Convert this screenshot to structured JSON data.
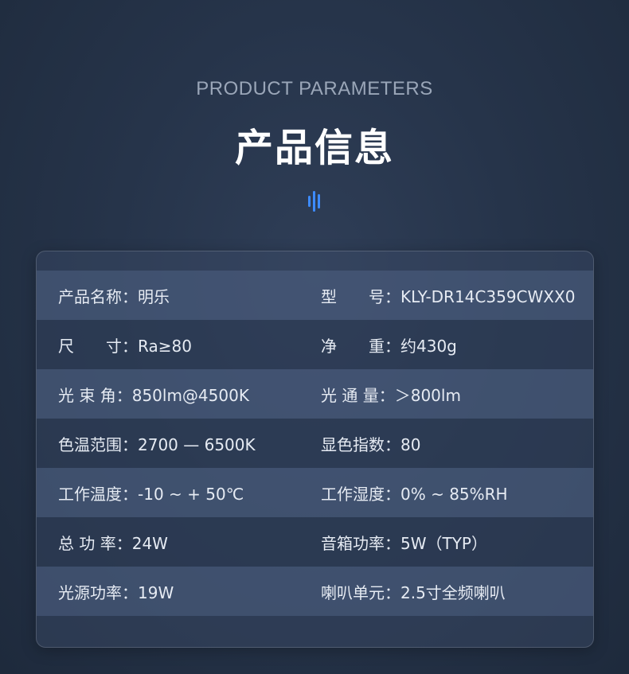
{
  "header": {
    "subtitle_en": "PRODUCT PARAMETERS",
    "title_cn": "产品信息"
  },
  "accent_color": "#3d8bff",
  "params": [
    {
      "left": "产品名称：明乐",
      "right": "型　　号：KLY-DR14C359CWXX0"
    },
    {
      "left": "尺　　寸：Ra≥80",
      "right": "净　　重：约430g"
    },
    {
      "left": "光 束 角：850lm@4500K",
      "right": "光 通 量：＞800lm"
    },
    {
      "left": "色温范围：2700 — 6500K",
      "right": "显色指数：80"
    },
    {
      "left": "工作温度：-10 ~ + 50℃",
      "right": "工作湿度：0% ~ 85%RH"
    },
    {
      "left": "总 功 率：24W",
      "right": "音箱功率：5W（TYP）"
    },
    {
      "left": "光源功率：19W",
      "right": "喇叭单元：2.5寸全频喇叭"
    }
  ]
}
